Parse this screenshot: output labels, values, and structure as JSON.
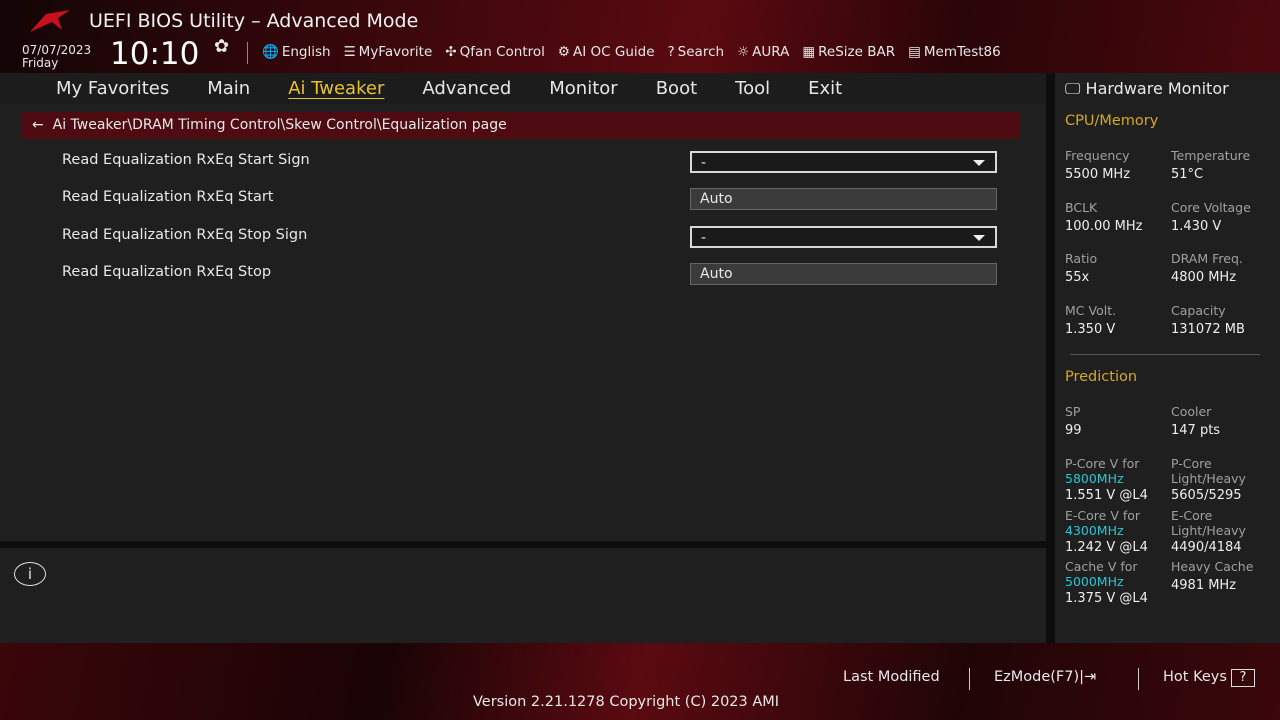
{
  "header": {
    "title": "UEFI BIOS Utility – Advanced Mode",
    "date": "07/07/2023",
    "day": "Friday",
    "time": "10:10",
    "tools": [
      {
        "icon": "globe-icon",
        "label": "English"
      },
      {
        "icon": "favorite-icon",
        "label": "MyFavorite"
      },
      {
        "icon": "fan-icon",
        "label": "Qfan Control"
      },
      {
        "icon": "ai-chip-icon",
        "label": "AI OC Guide"
      },
      {
        "icon": "search-icon",
        "label": "Search"
      },
      {
        "icon": "aura-icon",
        "label": "AURA"
      },
      {
        "icon": "resize-bar-icon",
        "label": "ReSize BAR"
      },
      {
        "icon": "memory-icon",
        "label": "MemTest86"
      }
    ]
  },
  "nav": {
    "tabs": [
      "My Favorites",
      "Main",
      "Ai Tweaker",
      "Advanced",
      "Monitor",
      "Boot",
      "Tool",
      "Exit"
    ],
    "active": "Ai Tweaker"
  },
  "breadcrumb": "Ai Tweaker\\DRAM Timing Control\\Skew Control\\Equalization page",
  "settings": [
    {
      "label": "Read Equalization RxEq Start Sign",
      "value": "-",
      "type": "select"
    },
    {
      "label": "Read Equalization RxEq Start",
      "value": "Auto",
      "type": "input"
    },
    {
      "label": "Read Equalization RxEq Stop Sign",
      "value": "-",
      "type": "select"
    },
    {
      "label": "Read Equalization RxEq Stop",
      "value": "Auto",
      "type": "input"
    }
  ],
  "hw": {
    "title": "Hardware Monitor",
    "cpu_title": "CPU/Memory",
    "cpu": [
      {
        "l": "Frequency",
        "v": "5500 MHz"
      },
      {
        "l": "Temperature",
        "v": "51°C"
      },
      {
        "l": "BCLK",
        "v": "100.00 MHz"
      },
      {
        "l": "Core Voltage",
        "v": "1.430 V"
      },
      {
        "l": "Ratio",
        "v": "55x"
      },
      {
        "l": "DRAM Freq.",
        "v": "4800 MHz"
      },
      {
        "l": "MC Volt.",
        "v": "1.350 V"
      },
      {
        "l": "Capacity",
        "v": "131072 MB"
      }
    ],
    "pred_title": "Prediction",
    "sp_l": "SP",
    "sp_v": "99",
    "cooler_l": "Cooler",
    "cooler_v": "147 pts",
    "pred": [
      {
        "l": "P-Core V for",
        "f": "5800MHz",
        "v": "1.551 V @L4",
        "l2": "P-Core",
        "l2b": "Light/Heavy",
        "v2": "5605/5295"
      },
      {
        "l": "E-Core V for",
        "f": "4300MHz",
        "v": "1.242 V @L4",
        "l2": "E-Core",
        "l2b": "Light/Heavy",
        "v2": "4490/4184"
      },
      {
        "l": "Cache V for",
        "f": "5000MHz",
        "v": "1.375 V @L4",
        "l2": "Heavy Cache",
        "l2b": "",
        "v2": "4981 MHz"
      }
    ]
  },
  "footer": {
    "last_modified": "Last Modified",
    "ezmode": "EzMode(F7)|",
    "hotkeys": "Hot Keys",
    "version": "Version 2.21.1278 Copyright (C) 2023 AMI"
  }
}
